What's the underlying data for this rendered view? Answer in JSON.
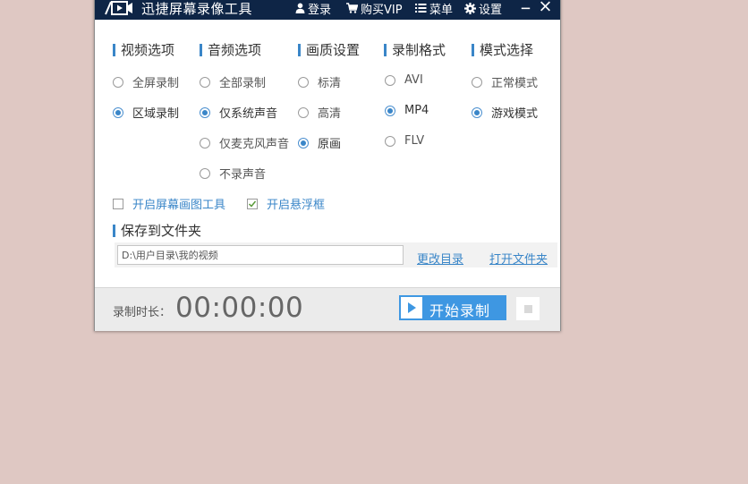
{
  "titlebar": {
    "app_title": "迅捷屏幕录像工具",
    "login": "登录",
    "vip": "购买VIP",
    "menu": "菜单",
    "settings": "设置"
  },
  "columns": {
    "video": {
      "heading": "视频选项",
      "options": [
        {
          "label": "全屏录制",
          "selected": false
        },
        {
          "label": "区域录制",
          "selected": true
        }
      ]
    },
    "audio": {
      "heading": "音频选项",
      "options": [
        {
          "label": "全部录制",
          "selected": false
        },
        {
          "label": "仅系统声音",
          "selected": true
        },
        {
          "label": "仅麦克风声音",
          "selected": false
        },
        {
          "label": "不录声音",
          "selected": false
        }
      ]
    },
    "quality": {
      "heading": "画质设置",
      "options": [
        {
          "label": "标清",
          "selected": false
        },
        {
          "label": "高清",
          "selected": false
        },
        {
          "label": "原画",
          "selected": true
        }
      ]
    },
    "format": {
      "heading": "录制格式",
      "options": [
        {
          "label": "AVI",
          "selected": false
        },
        {
          "label": "MP4",
          "selected": true
        },
        {
          "label": "FLV",
          "selected": false
        }
      ]
    },
    "mode": {
      "heading": "模式选择",
      "options": [
        {
          "label": "正常模式",
          "selected": false
        },
        {
          "label": "游戏模式",
          "selected": true
        }
      ]
    }
  },
  "checkboxes": {
    "draw_tool": {
      "label": "开启屏幕画图工具",
      "checked": false
    },
    "float_window": {
      "label": "开启悬浮框",
      "checked": true
    }
  },
  "save": {
    "heading": "保存到文件夹",
    "path": "D:\\用户目录\\我的视频",
    "change_dir": "更改目录",
    "open_folder": "打开文件夹"
  },
  "bottom": {
    "duration_label": "录制时长：",
    "duration_value": "00:00:00",
    "start_label": "开始录制"
  },
  "colors": {
    "titlebar": "#0e2546",
    "accent": "#3a86c8",
    "start_button": "#3e97e2",
    "background": "#dfc8c3"
  }
}
